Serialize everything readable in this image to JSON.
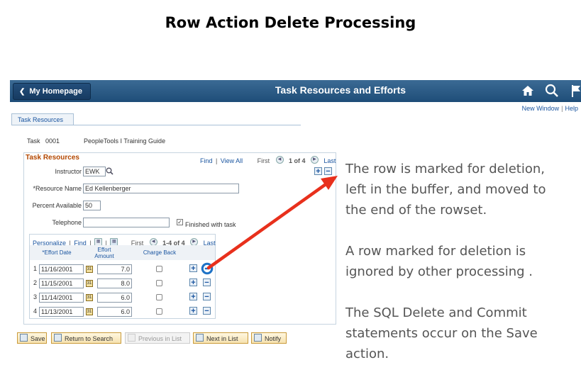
{
  "slide": {
    "title": "Row Action Delete Processing"
  },
  "header": {
    "home_label": "My Homepage",
    "page_title": "Task Resources and Efforts",
    "links": {
      "new_window": "New Window",
      "separator": "|",
      "help": "Help"
    },
    "icons": [
      "home-icon",
      "search-icon",
      "flag-icon"
    ]
  },
  "tab": {
    "label": "Task Resources"
  },
  "task": {
    "label": "Task",
    "id": "0001",
    "description": "PeopleTools I Training Guide"
  },
  "section": {
    "title": "Task Resources",
    "find": "Find",
    "sep": "|",
    "view_all": "View All",
    "first": "First",
    "range": "1 of 4",
    "last": "Last"
  },
  "form": {
    "instructor_label": "Instructor",
    "instructor_value": "EWK",
    "resource_label": "*Resource Name",
    "resource_value": "Ed Kellenberger",
    "percent_label": "Percent Available",
    "percent_value": "50",
    "telephone_label": "Telephone",
    "telephone_value": "",
    "finished_label": "Finished with task",
    "finished_checked": true
  },
  "grid": {
    "personalize": "Personalize",
    "find": "Find",
    "sep": "|",
    "first": "First",
    "range": "1-4 of 4",
    "last": "Last",
    "col_date": "*Effort Date",
    "col_effort": "Effort Amount",
    "col_charge": "Charge Back",
    "rows": [
      {
        "n": "1",
        "date": "11/16/2001",
        "amount": "7.0"
      },
      {
        "n": "2",
        "date": "11/15/2001",
        "amount": "8.0"
      },
      {
        "n": "3",
        "date": "11/14/2001",
        "amount": "6.0"
      },
      {
        "n": "4",
        "date": "11/13/2001",
        "amount": "6.0"
      }
    ]
  },
  "buttons": {
    "save": "Save",
    "return": "Return to Search",
    "previous": "Previous in List",
    "next": "Next in List",
    "notify": "Notify"
  },
  "notes": {
    "p1": [
      "The row is marked for deletion,",
      "left in the buffer, and moved to",
      "the end of the rowset."
    ],
    "p2": [
      "A row marked for deletion is",
      "ignored by other processing ."
    ],
    "p3": [
      "The SQL Delete and Commit",
      "statements occur on the Save",
      "action."
    ]
  },
  "colors": {
    "banner": "#2b5a86",
    "accent": "#e8301c",
    "highlight": "#1f73c6",
    "section": "#b34700"
  }
}
